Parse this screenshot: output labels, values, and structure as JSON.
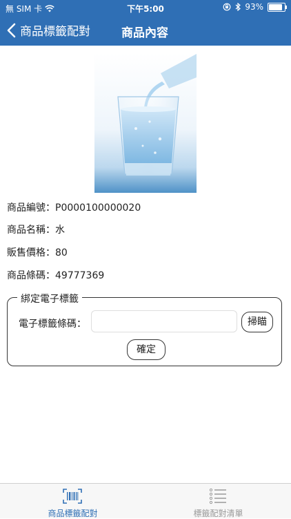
{
  "status_bar": {
    "carrier": "無 SIM 卡",
    "time": "下午5:00",
    "battery": "93%",
    "battery_level": 0.93
  },
  "nav": {
    "back_label": "商品標籤配對",
    "title": "商品內容"
  },
  "product": {
    "image": "glass-of-water",
    "code_label": "商品編號：",
    "code": "P0000100000020",
    "name_label": "商品名稱：",
    "name": "水",
    "price_label": "販售價格：",
    "price": "80",
    "barcode_label": "商品條碼：",
    "barcode": "49777369"
  },
  "bind_section": {
    "legend": "綁定電子標籤",
    "tag_label": "電子標籤條碼：",
    "tag_value": "",
    "scan_button": "掃瞄",
    "confirm_button": "確定"
  },
  "tabbar": {
    "items": [
      {
        "label": "商品標籤配對",
        "icon": "barcode-scan-icon",
        "active": true
      },
      {
        "label": "標籤配對清單",
        "icon": "list-icon",
        "active": false
      }
    ]
  },
  "colors": {
    "primary": "#2f6fb5",
    "inactive": "#9a9a9a"
  }
}
